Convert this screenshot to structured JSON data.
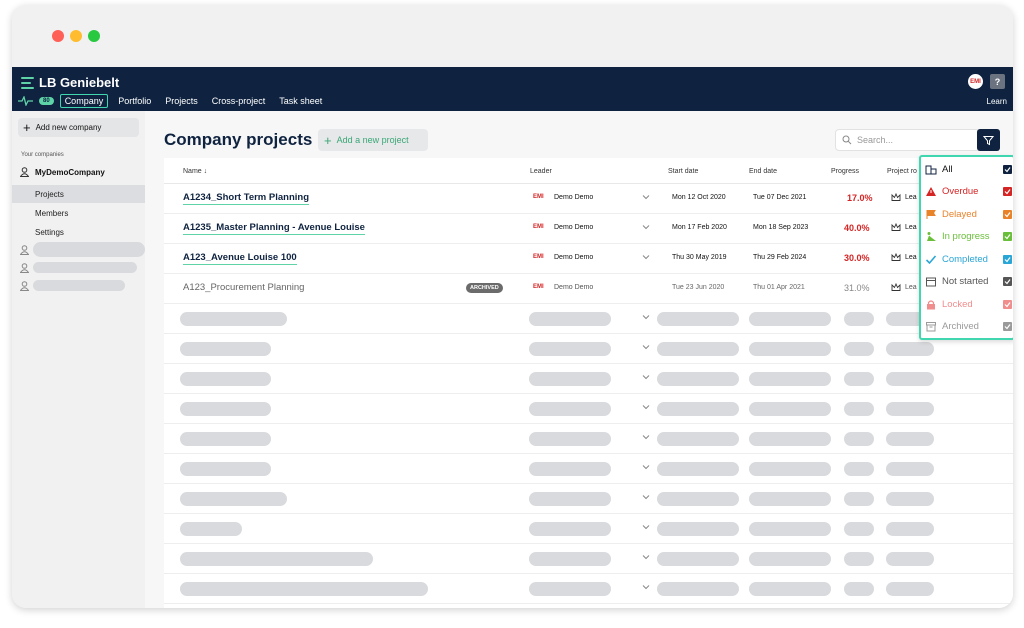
{
  "app": {
    "brand": "LB Geniebelt",
    "notif_count": "80",
    "avatar": "EMI",
    "help": "?",
    "learn": "Learn"
  },
  "nav": [
    {
      "label": "Company"
    },
    {
      "label": "Portfolio"
    },
    {
      "label": "Projects"
    },
    {
      "label": "Cross-project"
    },
    {
      "label": "Task sheet"
    }
  ],
  "sidebar": {
    "add_company": "Add new company",
    "section_label": "Your companies",
    "company": "MyDemoCompany",
    "links": [
      {
        "label": "Projects"
      },
      {
        "label": "Members"
      },
      {
        "label": "Settings"
      }
    ]
  },
  "main": {
    "title": "Company projects",
    "add_project": "Add a new project",
    "search_placeholder": "Search..."
  },
  "table": {
    "headers": {
      "name": "Name ↓",
      "leader": "Leader",
      "start": "Start date",
      "end": "End date",
      "progress": "Progress",
      "role": "Project ro"
    },
    "rows": [
      {
        "name": "A1234_Short Term Planning",
        "leader": "Demo Demo",
        "start": "Mon 12 Oct 2020",
        "end": "Tue 07 Dec 2021",
        "progress": "17.0%",
        "role": "Lea"
      },
      {
        "name": "A1235_Master Planning - Avenue Louise",
        "leader": "Demo Demo",
        "start": "Mon 17 Feb 2020",
        "end": "Mon 18 Sep 2023",
        "progress": "40.0%",
        "role": "Lea"
      },
      {
        "name": "A123_Avenue Louise 100",
        "leader": "Demo Demo",
        "start": "Thu 30 May 2019",
        "end": "Thu 29 Feb 2024",
        "progress": "30.0%",
        "role": "Lea"
      },
      {
        "name": "A123_Procurement Planning",
        "leader": "Demo Demo",
        "start": "Tue 23 Jun 2020",
        "end": "Thu 01 Apr 2021",
        "progress": "31.0%",
        "role": "Lea",
        "archived_tag": "ARCHIVED"
      }
    ],
    "leader_logo": "EMI"
  },
  "filter": {
    "options": [
      {
        "label": "All",
        "color": "#0f2340",
        "icon": "buildings-icon"
      },
      {
        "label": "Overdue",
        "color": "#d42424",
        "icon": "warning-icon"
      },
      {
        "label": "Delayed",
        "color": "#e8832a",
        "icon": "flag-icon"
      },
      {
        "label": "In progress",
        "color": "#6abf3a",
        "icon": "construction-icon"
      },
      {
        "label": "Completed",
        "color": "#2aa6d6",
        "icon": "check-icon"
      },
      {
        "label": "Not started",
        "color": "#555555",
        "icon": "calendar-icon"
      },
      {
        "label": "Locked",
        "color": "#f08d8d",
        "icon": "lock-icon"
      },
      {
        "label": "Archived",
        "color": "#9a9a9a",
        "icon": "archive-icon"
      }
    ]
  }
}
